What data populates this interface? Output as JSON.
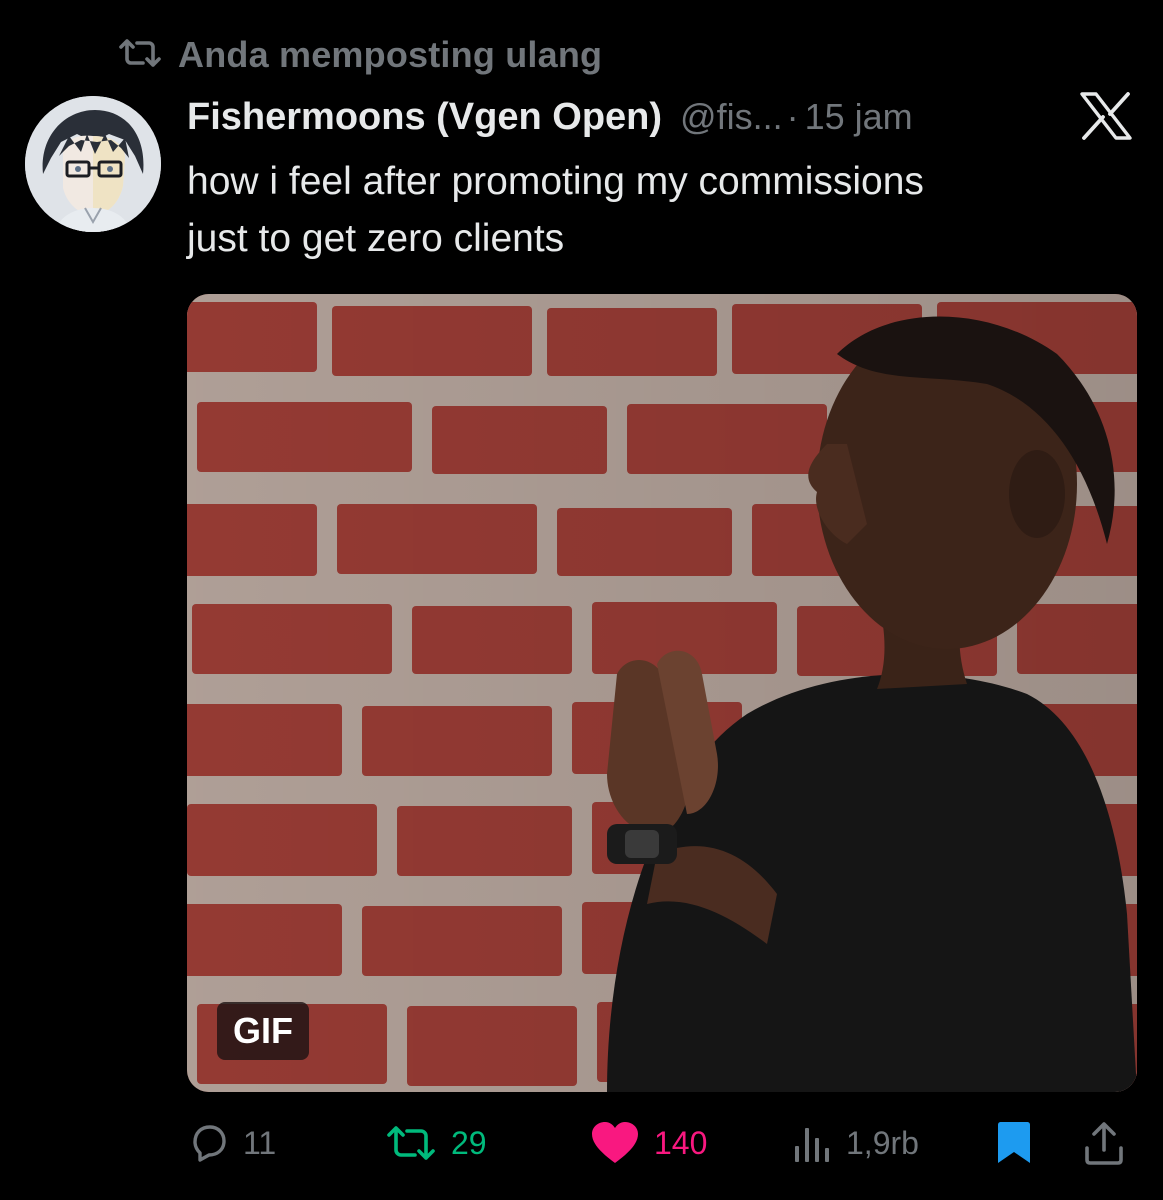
{
  "repost_header": {
    "text": "Anda memposting ulang",
    "icon": "repost-icon"
  },
  "tweet": {
    "author_name": "Fishermoons (Vgen Open)",
    "handle": "@fis...",
    "separator": "·",
    "time": "15 jam",
    "text_lines": [
      "how i feel after promoting my commissions",
      "just to get zero clients"
    ],
    "media_badge": "GIF",
    "platform_icon": "x-logo-icon"
  },
  "actions": {
    "replies": "11",
    "reposts": "29",
    "likes": "140",
    "views": "1,9rb"
  },
  "colors": {
    "background": "#000000",
    "text": "#e7e9ea",
    "muted": "#71767b",
    "repost_green": "#00ba7c",
    "like_pink": "#f91880",
    "bookmark_blue": "#1d9bf0"
  }
}
